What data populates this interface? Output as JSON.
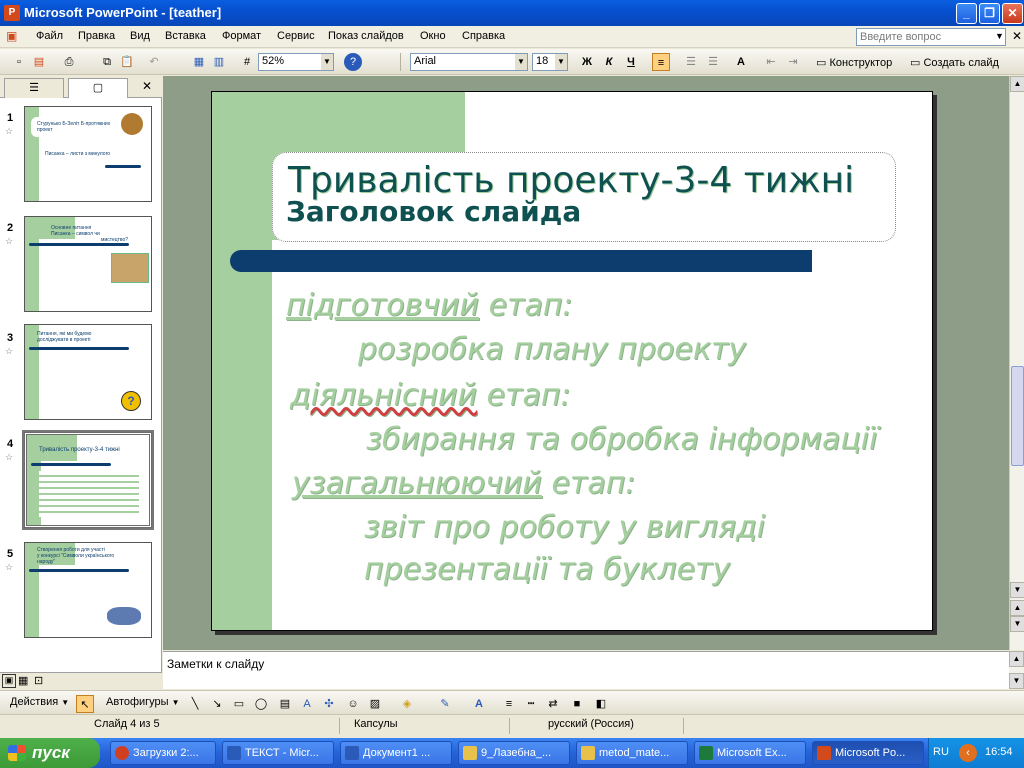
{
  "window": {
    "title": "Microsoft PowerPoint - [teather]"
  },
  "menu": {
    "items": [
      "Файл",
      "Правка",
      "Вид",
      "Вставка",
      "Формат",
      "Сервис",
      "Показ слайдов",
      "Окно",
      "Справка"
    ],
    "help_placeholder": "Введите вопрос"
  },
  "toolbar": {
    "zoom": "52%",
    "font": "Arial",
    "size": "18",
    "bold": "Ж",
    "italic": "К",
    "underline": "Ч",
    "designer": "Конструктор",
    "new_slide": "Создать слайд"
  },
  "slides": [
    {
      "num": "1",
      "lines": [
        "Стурунько Б-Зеліт Б-протяжних",
        "проект",
        "Писанка – листи з минулого"
      ]
    },
    {
      "num": "2",
      "lines": [
        "Основне питання",
        "Писанка – символ чи",
        "мистецтво?"
      ]
    },
    {
      "num": "3",
      "lines": [
        "Питання, які ми будемо",
        "досліджувати в проекті"
      ]
    },
    {
      "num": "4",
      "lines": [
        "Тривалість проекту-3-4 тижні"
      ]
    },
    {
      "num": "5",
      "lines": [
        "Створення роботи для участі",
        "у конкурсі \"Символи українського",
        "народу\""
      ]
    }
  ],
  "slide": {
    "title": "Тривалість проекту-3-4 тижні",
    "title_placeholder": "Заголовок слайда",
    "body": [
      {
        "u": "підготовчий",
        "rest": " етап:"
      },
      {
        "text": "розробка плану проекту"
      },
      {
        "u": "діяльнісний",
        "rest": " етап:"
      },
      {
        "text": "збирання та обробка інформації"
      },
      {
        "u": "узагальнюючий",
        "rest": " етап:"
      },
      {
        "text": "звіт про роботу у вигляді"
      },
      {
        "text": "презентації та буклету"
      }
    ]
  },
  "notes": {
    "placeholder": "Заметки к слайду"
  },
  "drawbar": {
    "actions": "Действия",
    "autoshapes": "Автофигуры"
  },
  "status": {
    "slide": "Слайд 4 из 5",
    "design": "Капсулы",
    "lang": "русский (Россия)"
  },
  "taskbar": {
    "start": "пуск",
    "tasks": [
      {
        "label": "Загрузки 2:...",
        "color": "#D04020"
      },
      {
        "label": "ТЕКСТ - Micr...",
        "color": "#2B5BB8"
      },
      {
        "label": "Документ1 ...",
        "color": "#2B5BB8"
      },
      {
        "label": "9_Лазебна_...",
        "color": "#E8C14A"
      },
      {
        "label": "metod_mate...",
        "color": "#E8C14A"
      },
      {
        "label": "Microsoft Ex...",
        "color": "#1E7A3A"
      },
      {
        "label": "Microsoft Po...",
        "color": "#D24A1C"
      }
    ],
    "lang": "RU",
    "time": "16:54"
  }
}
